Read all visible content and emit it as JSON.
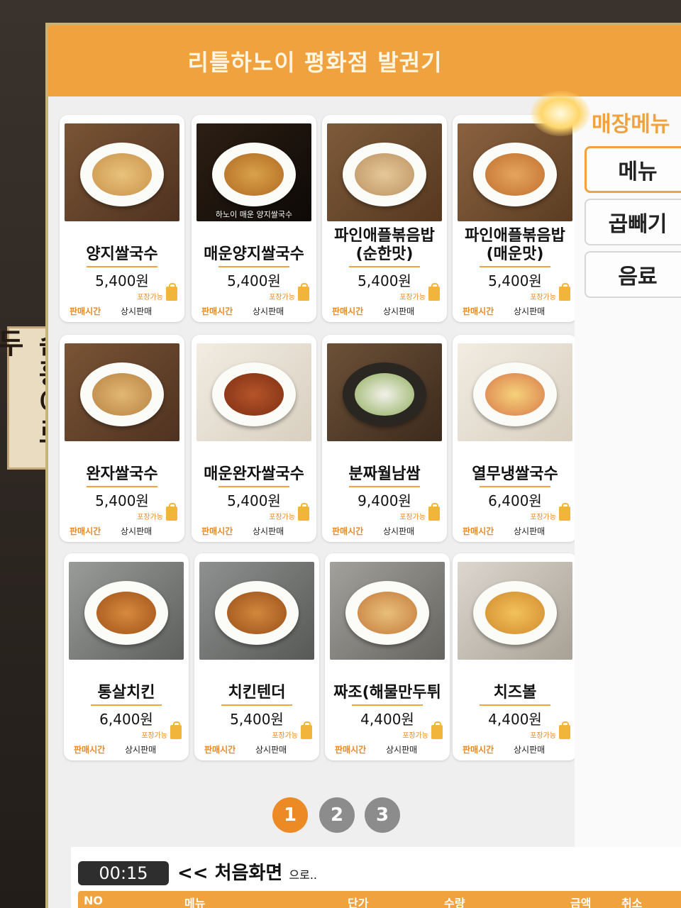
{
  "sign": {
    "text": "손흥이로두"
  },
  "header": {
    "title": "리틀하노이 평화점 발권기"
  },
  "side": {
    "title": "매장메뉴",
    "categories": [
      {
        "label": "메뉴",
        "active": true
      },
      {
        "label": "곱빼기",
        "active": false
      },
      {
        "label": "음료",
        "active": false
      }
    ]
  },
  "card_common": {
    "togo": "포장가능",
    "sale_label": "판매시간",
    "sale_value": "상시판매"
  },
  "items": [
    {
      "name": "양지쌀국수",
      "price": "5,400원"
    },
    {
      "name": "매운양지쌀국수",
      "price": "5,400원",
      "photo_caption": "하노이 매운 양지쌀국수"
    },
    {
      "name": "파인애플볶음밥(순한맛)",
      "price": "5,400원"
    },
    {
      "name": "파인애플볶음밥(매운맛)",
      "price": "5,400원"
    },
    {
      "name": "완자쌀국수",
      "price": "5,400원"
    },
    {
      "name": "매운완자쌀국수",
      "price": "5,400원"
    },
    {
      "name": "분짜월남쌈",
      "price": "9,400원"
    },
    {
      "name": "열무냉쌀국수",
      "price": "6,400원"
    },
    {
      "name": "통살치킨",
      "price": "6,400원"
    },
    {
      "name": "치킨텐더",
      "price": "5,400원"
    },
    {
      "name": "짜조(해물만두튀",
      "price": "4,400원"
    },
    {
      "name": "치즈볼",
      "price": "4,400원"
    }
  ],
  "pager": {
    "pages": [
      "1",
      "2",
      "3"
    ],
    "current": "1"
  },
  "footer": {
    "timer": "00:15",
    "home_prefix": "<<",
    "home_text": "처음화면",
    "home_suffix": "으로..",
    "columns": [
      "NO",
      "메뉴",
      "단가",
      "수량",
      "금액",
      "취소"
    ]
  }
}
